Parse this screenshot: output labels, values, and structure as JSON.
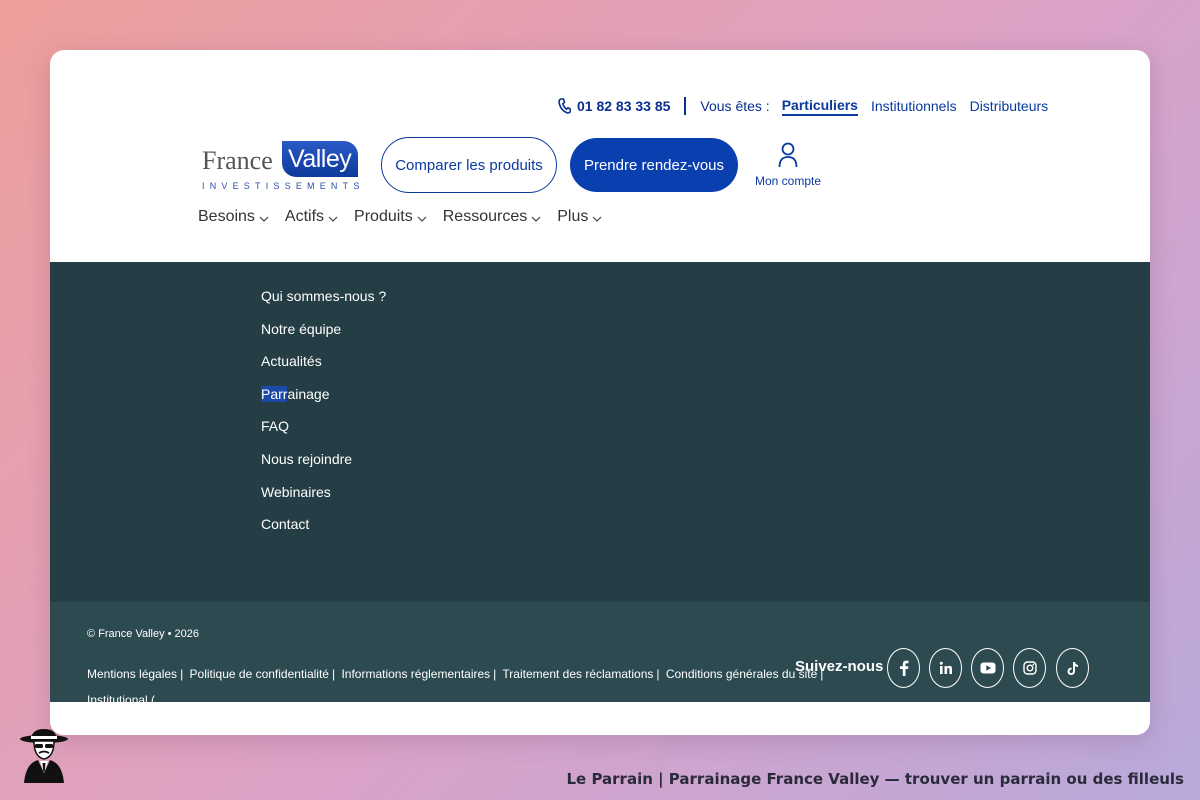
{
  "header": {
    "phone": "01 82 83 33 85",
    "you_are_label": "Vous êtes :",
    "audiences": [
      {
        "label": "Particuliers",
        "active": true
      },
      {
        "label": "Institutionnels",
        "active": false
      },
      {
        "label": "Distributeurs",
        "active": false
      }
    ],
    "logo": {
      "word1": "France",
      "word2": "Valley",
      "sub": "INVESTISSEMENTS"
    },
    "compare_button": "Comparer les produits",
    "appointment_button": "Prendre rendez-vous",
    "account_label": "Mon compte",
    "nav": [
      "Besoins",
      "Actifs",
      "Produits",
      "Ressources",
      "Plus"
    ]
  },
  "menu": {
    "items": [
      "Qui sommes-nous ?",
      "Notre équipe",
      "Actualités",
      "Parrainage",
      "FAQ",
      "Nous rejoindre",
      "Webinaires",
      "Contact"
    ],
    "highlight_prefix": "Parr",
    "highlight_rest": "ainage"
  },
  "footer": {
    "copyright": "© France Valley • 2026",
    "legal_links": [
      "Mentions légales",
      "Politique de confidentialité",
      "Informations réglementaires",
      "Traitement des réclamations",
      "Conditions générales du site"
    ],
    "institutional": "Institutional (",
    "follow_label": "Suivez-nous",
    "socials": [
      "facebook-icon",
      "linkedin-icon",
      "youtube-icon",
      "instagram-icon",
      "tiktok-icon"
    ]
  },
  "caption": "Le Parrain | Parrainage France Valley — trouver un parrain ou des filleuls",
  "colors": {
    "brand_blue": "#0a3fb0",
    "dark_menu": "#253e45",
    "footer": "#2d4a51"
  }
}
